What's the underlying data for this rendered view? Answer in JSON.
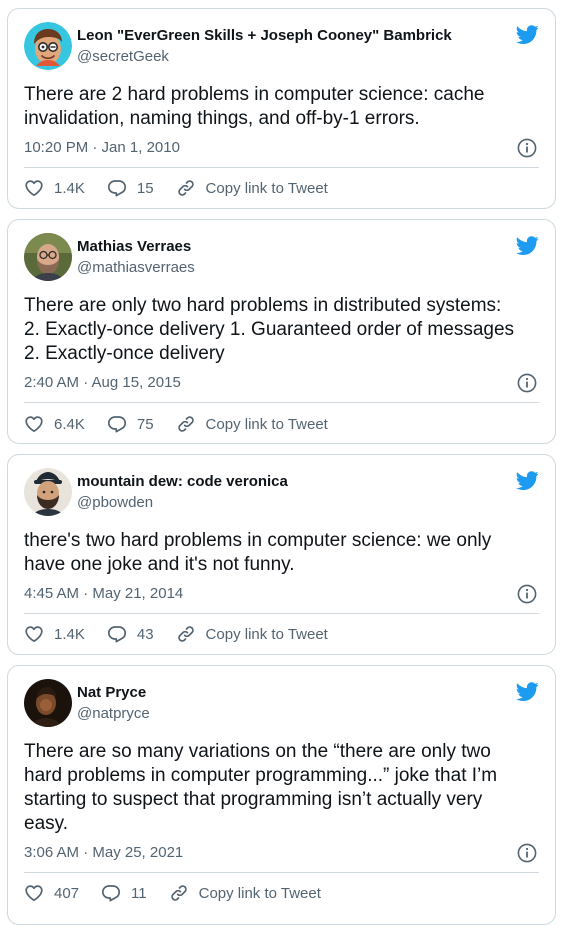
{
  "tweets": [
    {
      "name": "Leon \"EverGreen Skills + Joseph Cooney\" Bambrick",
      "handle": "@secretGeek",
      "text": "There are 2 hard problems in computer science: cache\ninvalidation, naming things, and off-by-1 errors.",
      "timestamp": "10:20 PM · Jan 1, 2010",
      "likes": "1.4K",
      "replies": "15",
      "copy_link": "Copy link to Tweet"
    },
    {
      "name": "Mathias Verraes",
      "handle": "@mathiasverraes",
      "text": "There are only two hard problems in distributed systems:\n2. Exactly-once delivery 1. Guaranteed order of messages\n2. Exactly-once delivery",
      "timestamp": "2:40 AM · Aug 15, 2015",
      "likes": "6.4K",
      "replies": "75",
      "copy_link": "Copy link to Tweet"
    },
    {
      "name": "mountain dew: code veronica",
      "handle": "@pbowden",
      "text": "there's two hard problems in computer science: we only\nhave one joke and it's not funny.",
      "timestamp": "4:45 AM · May 21, 2014",
      "likes": "1.4K",
      "replies": "43",
      "copy_link": "Copy link to Tweet"
    },
    {
      "name": "Nat Pryce",
      "handle": "@natpryce",
      "text": "There are so many variations on the “there are only two\nhard problems in computer programming...” joke that I’m\nstarting to suspect that programming isn’t actually very\neasy.",
      "timestamp": "3:06 AM · May 25, 2021",
      "likes": "407",
      "replies": "11",
      "copy_link": "Copy link to Tweet"
    }
  ],
  "icons": {
    "brand": "twitter-bird-icon",
    "info": "info-icon",
    "like": "heart-icon",
    "reply": "reply-icon",
    "link": "link-icon"
  },
  "colors": {
    "twitter_blue": "#1d9bf0",
    "secondary_text": "#536471",
    "border": "#cfd9de",
    "text": "#0f1419"
  }
}
